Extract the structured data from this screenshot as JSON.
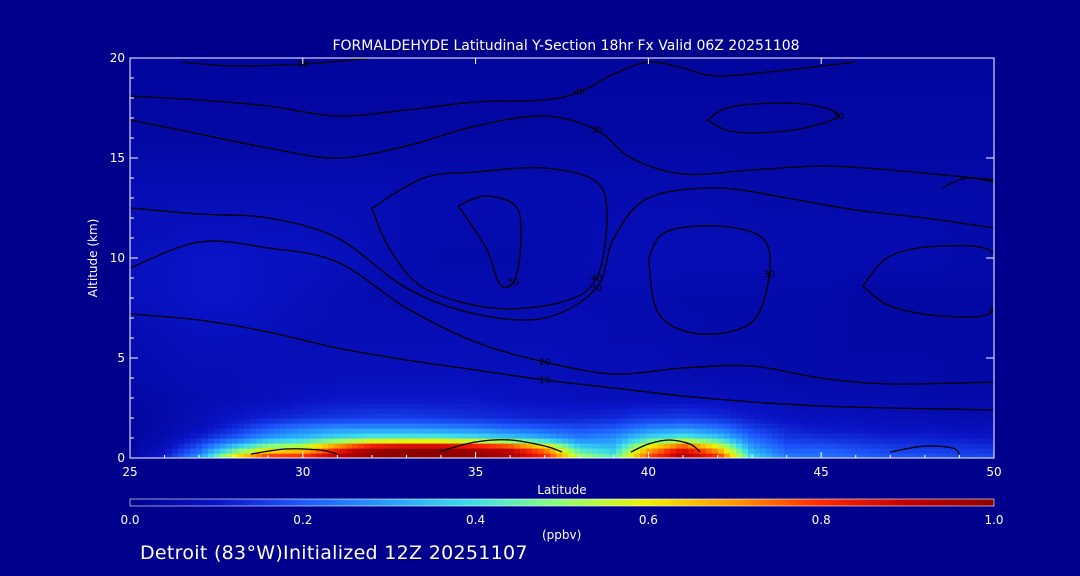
{
  "chart_data": {
    "type": "heatmap",
    "title": "FORMALDEHYDE Latitudinal Y-Section 18hr  Fx Valid 06Z 20251108",
    "xlabel": "Latitude",
    "ylabel": "Altitude (km)",
    "xlim": [
      25,
      50
    ],
    "ylim": [
      0,
      20
    ],
    "x_ticks": [
      "25",
      "30",
      "35",
      "40",
      "45",
      "50"
    ],
    "y_ticks": [
      "0",
      "5",
      "10",
      "15",
      "20"
    ],
    "colorbar": {
      "label": "(ppbv)",
      "min": 0.0,
      "max": 1.0,
      "ticks": [
        "0.0",
        "0.2",
        "0.4",
        "0.6",
        "0.8",
        "1.0"
      ],
      "colormap": [
        "#00008c",
        "#0a14c8",
        "#1e5aff",
        "#28a0ff",
        "#40e0e8",
        "#90ff70",
        "#f0f000",
        "#ff9600",
        "#ff2800",
        "#c00000",
        "#8c0000"
      ]
    },
    "field": {
      "lat": [
        25,
        26,
        27,
        28,
        29,
        30,
        31,
        32,
        33,
        34,
        35,
        36,
        37,
        38,
        39,
        40,
        41,
        42,
        43,
        44,
        45,
        46,
        47,
        48,
        49,
        50
      ],
      "alt_km": [
        0,
        0.5,
        1,
        1.5,
        2,
        3,
        4,
        6,
        8,
        10,
        13,
        16,
        20
      ],
      "ppbv": [
        [
          0.04,
          0.12,
          0.3,
          0.65,
          0.85,
          0.85,
          0.95,
          1.0,
          1.0,
          1.0,
          1.0,
          0.95,
          0.85,
          0.55,
          0.45,
          0.8,
          0.95,
          0.85,
          0.4,
          0.25,
          0.25,
          0.22,
          0.2,
          0.2,
          0.18,
          0.18
        ],
        [
          0.03,
          0.08,
          0.2,
          0.4,
          0.55,
          0.6,
          0.8,
          0.95,
          1.0,
          1.0,
          0.95,
          0.88,
          0.7,
          0.4,
          0.35,
          0.65,
          0.85,
          0.65,
          0.3,
          0.2,
          0.2,
          0.18,
          0.16,
          0.15,
          0.15,
          0.14
        ],
        [
          0.03,
          0.06,
          0.12,
          0.2,
          0.3,
          0.35,
          0.4,
          0.45,
          0.45,
          0.45,
          0.42,
          0.38,
          0.32,
          0.25,
          0.28,
          0.4,
          0.45,
          0.38,
          0.22,
          0.15,
          0.14,
          0.13,
          0.12,
          0.12,
          0.11,
          0.1
        ],
        [
          0.03,
          0.05,
          0.08,
          0.13,
          0.2,
          0.25,
          0.28,
          0.28,
          0.28,
          0.27,
          0.25,
          0.22,
          0.2,
          0.18,
          0.2,
          0.26,
          0.28,
          0.24,
          0.16,
          0.12,
          0.1,
          0.1,
          0.09,
          0.09,
          0.08,
          0.08
        ],
        [
          0.03,
          0.05,
          0.07,
          0.1,
          0.12,
          0.14,
          0.15,
          0.16,
          0.16,
          0.15,
          0.14,
          0.13,
          0.12,
          0.12,
          0.13,
          0.15,
          0.16,
          0.14,
          0.11,
          0.09,
          0.08,
          0.08,
          0.07,
          0.07,
          0.06,
          0.06
        ],
        [
          0.04,
          0.05,
          0.06,
          0.07,
          0.08,
          0.09,
          0.1,
          0.1,
          0.1,
          0.1,
          0.1,
          0.09,
          0.09,
          0.08,
          0.08,
          0.08,
          0.08,
          0.08,
          0.07,
          0.07,
          0.06,
          0.06,
          0.06,
          0.05,
          0.05,
          0.05
        ],
        [
          0.05,
          0.06,
          0.07,
          0.07,
          0.08,
          0.08,
          0.08,
          0.08,
          0.08,
          0.08,
          0.08,
          0.08,
          0.08,
          0.07,
          0.07,
          0.07,
          0.06,
          0.06,
          0.06,
          0.05,
          0.05,
          0.05,
          0.05,
          0.05,
          0.04,
          0.04
        ],
        [
          0.06,
          0.07,
          0.08,
          0.08,
          0.08,
          0.07,
          0.07,
          0.07,
          0.07,
          0.07,
          0.07,
          0.07,
          0.07,
          0.07,
          0.06,
          0.06,
          0.06,
          0.05,
          0.05,
          0.05,
          0.05,
          0.04,
          0.04,
          0.04,
          0.04,
          0.04
        ],
        [
          0.08,
          0.09,
          0.1,
          0.1,
          0.09,
          0.08,
          0.07,
          0.06,
          0.06,
          0.06,
          0.06,
          0.06,
          0.06,
          0.06,
          0.06,
          0.06,
          0.05,
          0.05,
          0.05,
          0.05,
          0.05,
          0.04,
          0.04,
          0.04,
          0.04,
          0.04
        ],
        [
          0.08,
          0.09,
          0.1,
          0.1,
          0.09,
          0.09,
          0.08,
          0.07,
          0.06,
          0.05,
          0.05,
          0.05,
          0.06,
          0.06,
          0.07,
          0.07,
          0.07,
          0.07,
          0.07,
          0.06,
          0.06,
          0.06,
          0.06,
          0.06,
          0.05,
          0.05
        ],
        [
          0.07,
          0.07,
          0.07,
          0.07,
          0.07,
          0.07,
          0.07,
          0.07,
          0.06,
          0.06,
          0.06,
          0.06,
          0.06,
          0.06,
          0.06,
          0.06,
          0.06,
          0.06,
          0.05,
          0.05,
          0.05,
          0.05,
          0.05,
          0.05,
          0.05,
          0.05
        ],
        [
          0.04,
          0.04,
          0.04,
          0.04,
          0.04,
          0.04,
          0.04,
          0.04,
          0.04,
          0.04,
          0.04,
          0.04,
          0.04,
          0.04,
          0.04,
          0.04,
          0.04,
          0.04,
          0.04,
          0.04,
          0.04,
          0.04,
          0.04,
          0.04,
          0.04,
          0.04
        ],
        [
          0.03,
          0.03,
          0.03,
          0.03,
          0.03,
          0.03,
          0.03,
          0.03,
          0.03,
          0.03,
          0.03,
          0.03,
          0.03,
          0.03,
          0.03,
          0.03,
          0.03,
          0.03,
          0.03,
          0.03,
          0.03,
          0.03,
          0.03,
          0.03,
          0.03,
          0.03
        ]
      ]
    },
    "contours": [
      {
        "label": "10",
        "points": [
          [
            25,
            7.2
          ],
          [
            27,
            6.9
          ],
          [
            29,
            6.3
          ],
          [
            31,
            5.5
          ],
          [
            33,
            4.9
          ],
          [
            35,
            4.4
          ],
          [
            37,
            3.9
          ],
          [
            39,
            3.5
          ],
          [
            41,
            3.1
          ],
          [
            43,
            2.8
          ],
          [
            45,
            2.6
          ],
          [
            47,
            2.5
          ],
          [
            50,
            2.4
          ]
        ]
      },
      {
        "label": "20",
        "points": [
          [
            25,
            9.5
          ],
          [
            27,
            10.8
          ],
          [
            29,
            10.5
          ],
          [
            31,
            9.8
          ],
          [
            33,
            7.5
          ],
          [
            35,
            5.8
          ],
          [
            37,
            4.8
          ],
          [
            39,
            4.2
          ],
          [
            41,
            4.5
          ],
          [
            43,
            4.6
          ],
          [
            45,
            4.0
          ],
          [
            47,
            3.7
          ],
          [
            50,
            3.8
          ]
        ]
      },
      {
        "label": "30",
        "points": [
          [
            25,
            12.5
          ],
          [
            27,
            12.2
          ],
          [
            29,
            12.0
          ],
          [
            31,
            11.0
          ],
          [
            33,
            8.5
          ],
          [
            35,
            7.2
          ],
          [
            37,
            7.0
          ],
          [
            38.5,
            8.5
          ],
          [
            39,
            11.0
          ],
          [
            40,
            13.0
          ],
          [
            42,
            13.5
          ],
          [
            44,
            13.0
          ],
          [
            46,
            12.4
          ],
          [
            48,
            12.0
          ],
          [
            50,
            11.5
          ]
        ]
      },
      {
        "label": "40",
        "points": [
          [
            32,
            12.5
          ],
          [
            33.5,
            14.0
          ],
          [
            35,
            14.3
          ],
          [
            37,
            14.5
          ],
          [
            38.5,
            13.8
          ],
          [
            38.8,
            12.0
          ],
          [
            38.5,
            9.0
          ],
          [
            37.5,
            7.8
          ],
          [
            35.5,
            7.5
          ],
          [
            33.5,
            8.5
          ],
          [
            32.5,
            10.5
          ],
          [
            32,
            12.5
          ]
        ]
      },
      {
        "label": "30",
        "points": [
          [
            40,
            10.0
          ],
          [
            40.5,
            11.3
          ],
          [
            42,
            11.6
          ],
          [
            43.3,
            11.0
          ],
          [
            43.5,
            9.2
          ],
          [
            43.0,
            6.8
          ],
          [
            41.5,
            6.2
          ],
          [
            40.3,
            7.2
          ],
          [
            40,
            10.0
          ]
        ]
      },
      {
        "label": "40",
        "points": [
          [
            46.2,
            8.6
          ],
          [
            47,
            10.1
          ],
          [
            48.5,
            10.6
          ],
          [
            50,
            10.2
          ],
          [
            50,
            7.4
          ],
          [
            48.5,
            7.1
          ],
          [
            47.0,
            7.6
          ],
          [
            46.2,
            8.6
          ]
        ]
      },
      {
        "label": "50",
        "points": [
          [
            34.5,
            12.6
          ],
          [
            35.3,
            13.1
          ],
          [
            36.2,
            12.5
          ],
          [
            36.3,
            10.5
          ],
          [
            36.1,
            8.8
          ],
          [
            35.7,
            8.7
          ],
          [
            35.3,
            10.5
          ],
          [
            34.5,
            12.6
          ]
        ]
      },
      {
        "label": "30",
        "points": [
          [
            25,
            16.9
          ],
          [
            27,
            16.2
          ],
          [
            29,
            15.5
          ],
          [
            31,
            15.0
          ],
          [
            33,
            15.6
          ],
          [
            35,
            16.6
          ],
          [
            37,
            17.1
          ],
          [
            38.5,
            16.4
          ],
          [
            39.5,
            15.0
          ],
          [
            41,
            14.2
          ],
          [
            43,
            14.4
          ],
          [
            45,
            14.6
          ],
          [
            47,
            14.4
          ],
          [
            50,
            13.9
          ]
        ]
      },
      {
        "label": "40",
        "points": [
          [
            25,
            18.1
          ],
          [
            27,
            17.9
          ],
          [
            29,
            17.6
          ],
          [
            31,
            17.1
          ],
          [
            33,
            17.4
          ],
          [
            35,
            17.8
          ],
          [
            37,
            17.9
          ],
          [
            38,
            18.3
          ],
          [
            39,
            19.2
          ],
          [
            40,
            19.8
          ],
          [
            41,
            19.5
          ],
          [
            42,
            19.1
          ],
          [
            44,
            19.4
          ],
          [
            46,
            19.8
          ]
        ]
      },
      {
        "label": "30",
        "points": [
          [
            41.7,
            16.9
          ],
          [
            42.5,
            17.6
          ],
          [
            44.5,
            17.7
          ],
          [
            45.5,
            17.1
          ],
          [
            44.2,
            16.4
          ],
          [
            42.5,
            16.3
          ],
          [
            41.7,
            16.9
          ]
        ]
      },
      {
        "label": "30",
        "points": [
          [
            26.5,
            19.8
          ],
          [
            28,
            19.6
          ],
          [
            30,
            19.7
          ],
          [
            32,
            20.0
          ]
        ]
      },
      {
        "label": "",
        "points": [
          [
            48.5,
            13.5
          ],
          [
            49.2,
            14.0
          ],
          [
            50,
            13.8
          ]
        ]
      },
      {
        "label": "",
        "points": [
          [
            34,
            0.35
          ],
          [
            35,
            0.8
          ],
          [
            36,
            0.9
          ],
          [
            37,
            0.6
          ],
          [
            37.5,
            0.3
          ]
        ]
      },
      {
        "label": "",
        "points": [
          [
            39.5,
            0.3
          ],
          [
            40,
            0.7
          ],
          [
            40.6,
            0.9
          ],
          [
            41.2,
            0.7
          ],
          [
            41.5,
            0.3
          ]
        ]
      },
      {
        "label": "",
        "points": [
          [
            28.5,
            0.2
          ],
          [
            29.5,
            0.45
          ],
          [
            30.5,
            0.4
          ],
          [
            31,
            0.2
          ]
        ]
      },
      {
        "label": "",
        "points": [
          [
            47,
            0.3
          ],
          [
            48,
            0.6
          ],
          [
            48.8,
            0.5
          ],
          [
            49.0,
            0.2
          ]
        ]
      }
    ]
  },
  "footer": {
    "location_text": "Detroit (83°W)Initialized 12Z 20251107"
  },
  "colors": {
    "background": "#00008c",
    "contour_line": "#000000",
    "text": "#ffffff"
  }
}
